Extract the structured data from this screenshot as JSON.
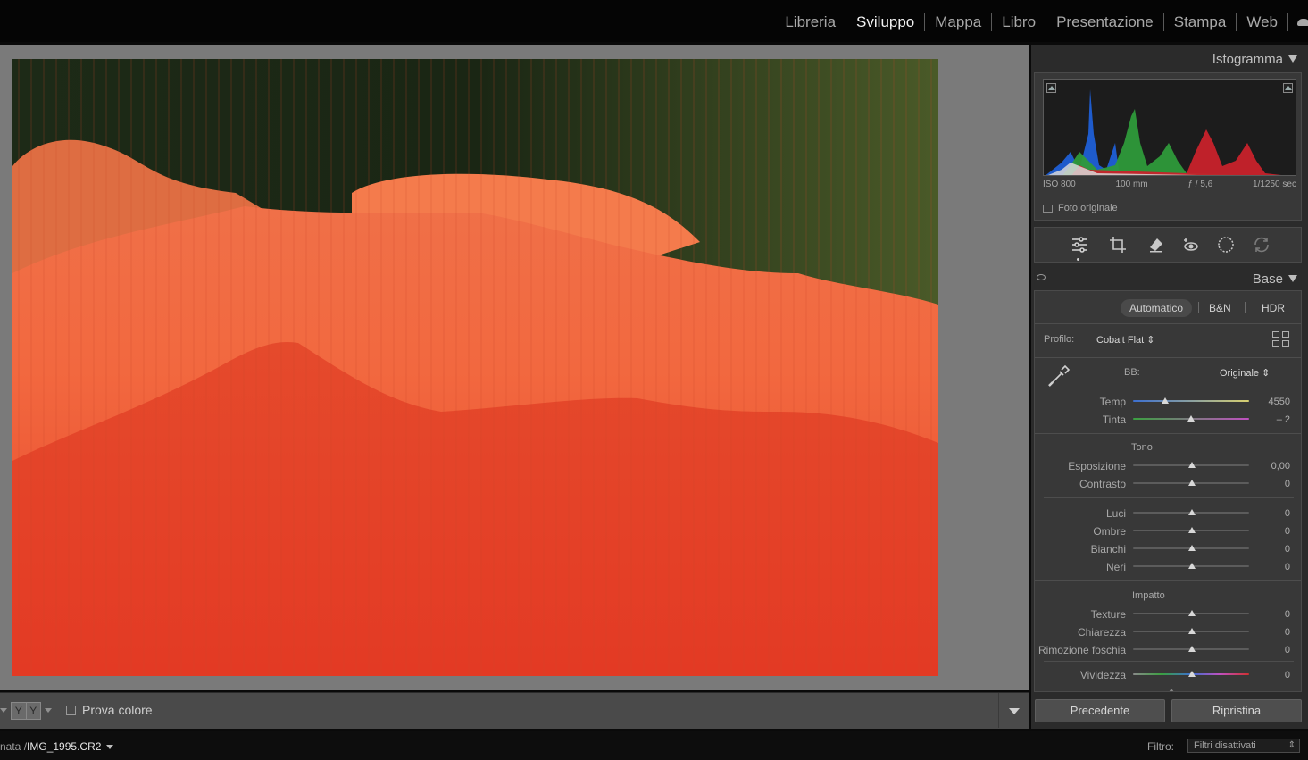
{
  "modules": [
    "Libreria",
    "Sviluppo",
    "Mappa",
    "Libro",
    "Presentazione",
    "Stampa",
    "Web"
  ],
  "active_module": "Sviluppo",
  "toolbar": {
    "view_mode_label": "Y Y",
    "soft_proof_label": "Prova colore"
  },
  "filmstrip": {
    "path_prefix": "nata /",
    "filename": "IMG_1995.CR2",
    "filter_label": "Filtro:",
    "filter_value": "Filtri disattivati"
  },
  "histogram": {
    "title": "Istogramma",
    "iso": "ISO 800",
    "focal": "100 mm",
    "aperture": "ƒ / 5,6",
    "shutter": "1/1250 sec",
    "original_photo_label": "Foto originale",
    "colors": {
      "blue": "#1f5fd6",
      "green": "#2e9a3a",
      "red": "#c8222b"
    }
  },
  "tools": [
    "edit-sliders-icon",
    "crop-icon",
    "heal-eraser-icon",
    "redeye-icon",
    "mask-icon",
    "presets-icon"
  ],
  "base": {
    "title": "Base",
    "treatments": [
      "Automatico",
      "B&N",
      "HDR"
    ],
    "profile_label": "Profilo:",
    "profile_value": "Cobalt Flat ⇕",
    "wb_label": "BB:",
    "wb_value": "Originale ⇕",
    "tono_title": "Tono",
    "impatto_title": "Impatto",
    "sliders": {
      "temp": {
        "label": "Temp",
        "value": "4550"
      },
      "tinta": {
        "label": "Tinta",
        "value": "– 2"
      },
      "esposizione": {
        "label": "Esposizione",
        "value": "0,00"
      },
      "contrasto": {
        "label": "Contrasto",
        "value": "0"
      },
      "luci": {
        "label": "Luci",
        "value": "0"
      },
      "ombre": {
        "label": "Ombre",
        "value": "0"
      },
      "bianchi": {
        "label": "Bianchi",
        "value": "0"
      },
      "neri": {
        "label": "Neri",
        "value": "0"
      },
      "texture": {
        "label": "Texture",
        "value": "0"
      },
      "chiarezza": {
        "label": "Chiarezza",
        "value": "0"
      },
      "foschia": {
        "label": "Rimozione foschia",
        "value": "0"
      },
      "vividezza": {
        "label": "Vividezza",
        "value": "0"
      }
    }
  },
  "buttons": {
    "previous": "Precedente",
    "reset": "Ripristina"
  }
}
